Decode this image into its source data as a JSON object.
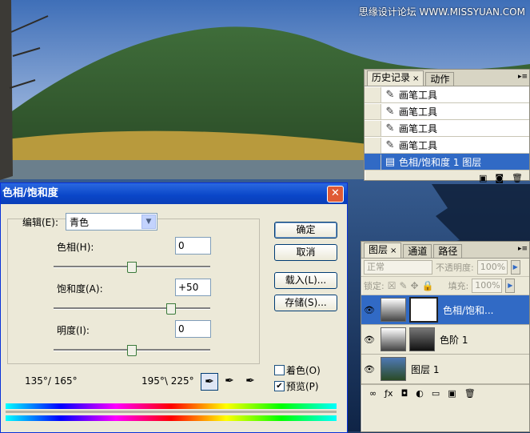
{
  "watermark": "思缘设计论坛 WWW.MISSYUAN.COM",
  "history_panel": {
    "tabs": [
      {
        "label": "历史记录",
        "close": "×"
      },
      {
        "label": "动作"
      }
    ],
    "menu_icon": "panel-menu-icon",
    "items": [
      {
        "label": "画笔工具",
        "icon": "brush-icon"
      },
      {
        "label": "画笔工具",
        "icon": "brush-icon"
      },
      {
        "label": "画笔工具",
        "icon": "brush-icon"
      },
      {
        "label": "画笔工具",
        "icon": "brush-icon"
      },
      {
        "label": "色相/饱和度 1 图层",
        "icon": "layer-state-icon",
        "selected": true
      }
    ],
    "footer_icons": [
      "new-document-icon",
      "snapshot-icon",
      "trash-icon"
    ]
  },
  "layers_panel": {
    "tabs": [
      {
        "label": "图层",
        "close": "×"
      },
      {
        "label": "通道"
      },
      {
        "label": "路径"
      }
    ],
    "blend_mode": "正常",
    "opacity_label": "不透明度:",
    "opacity_value": "100%",
    "lock_label": "锁定:",
    "fill_label": "填充:",
    "fill_value": "100%",
    "layers": [
      {
        "name": "色相/饱和...",
        "type": "adjustment",
        "selected": true
      },
      {
        "name": "色阶 1",
        "type": "adjustment"
      },
      {
        "name": "图层 1",
        "type": "image"
      }
    ],
    "footer_icons": [
      "link-icon",
      "fx-icon",
      "mask-icon",
      "adjustment-icon",
      "folder-icon",
      "new-layer-icon",
      "trash-icon"
    ]
  },
  "dialog": {
    "title": "色相/饱和度",
    "edit_label": "编辑(E):",
    "edit_value": "青色",
    "hue_label": "色相(H):",
    "hue_value": "0",
    "saturation_label": "饱和度(A):",
    "saturation_value": "+50",
    "lightness_label": "明度(I):",
    "lightness_value": "0",
    "buttons": {
      "ok": "确定",
      "cancel": "取消",
      "load": "载入(L)...",
      "save": "存储(S)..."
    },
    "colorize_label": "着色(O)",
    "colorize_checked": false,
    "preview_label": "预览(P)",
    "preview_checked": true,
    "range_left": "135°/ 165°",
    "range_right": "195°\\ 225°",
    "sliders": {
      "hue_level": 0.5,
      "saturation_level": 0.75,
      "lightness_level": 0.5
    }
  }
}
